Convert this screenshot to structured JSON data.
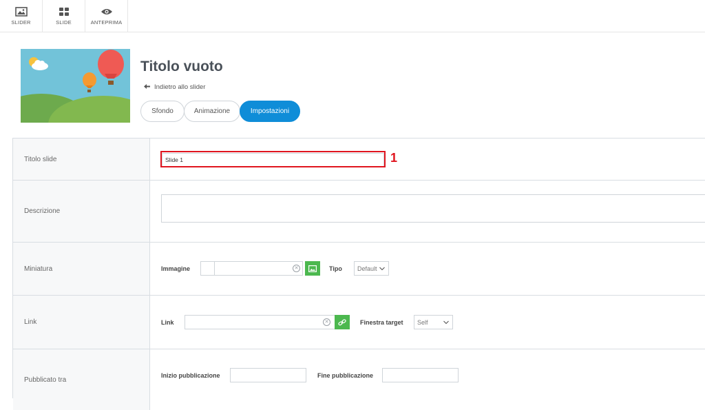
{
  "toolbar": {
    "items": [
      {
        "label": "SLIDER",
        "icon": "image-icon"
      },
      {
        "label": "SLIDE",
        "icon": "grid-icon"
      },
      {
        "label": "ANTEPRIMA",
        "icon": "eye-icon"
      }
    ]
  },
  "header": {
    "title": "Titolo vuoto",
    "back_label": "Indietro allo slider",
    "tabs": [
      "Sfondo",
      "Animazione",
      "Impostazioni"
    ],
    "active_tab": "Impostazioni"
  },
  "form": {
    "titolo_slide": {
      "label": "Titolo slide",
      "value": "Slide 1"
    },
    "descrizione": {
      "label": "Descrizione",
      "value": ""
    },
    "miniatura": {
      "label": "Miniatura",
      "immagine_label": "Immagine",
      "tipo_label": "Tipo",
      "tipo_value": "Default"
    },
    "link": {
      "label": "Link",
      "link_label": "Link",
      "link_value": "",
      "target_label": "Finestra target",
      "target_value": "Self"
    },
    "pubblicato": {
      "label": "Pubblicato tra",
      "start_label": "Inizio pubblicazione",
      "end_label": "Fine pubblicazione"
    }
  },
  "annotation": {
    "marker": "1"
  },
  "colors": {
    "accent": "#0f8dd8",
    "green": "#4cb84f",
    "highlight": "#e0141e"
  }
}
